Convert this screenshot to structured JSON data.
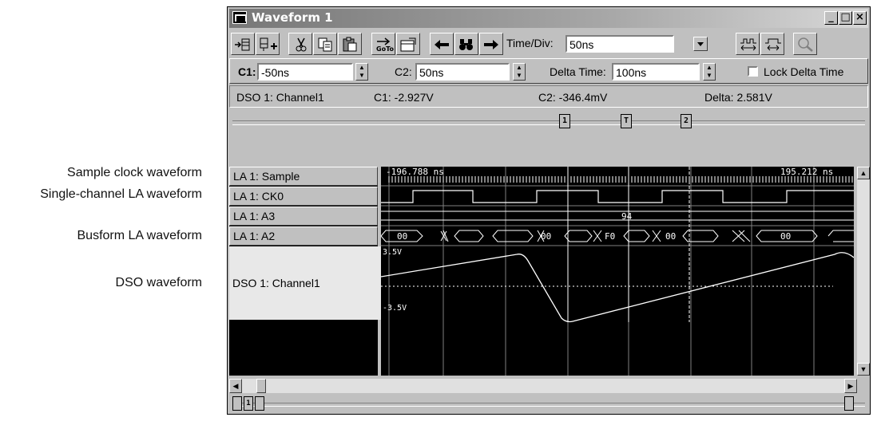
{
  "callouts": [
    "Sample clock waveform",
    "Single-channel LA waveform",
    "Busform LA waveform",
    "DSO waveform"
  ],
  "window": {
    "title": "Waveform 1",
    "controls": {
      "minimize": "_",
      "maximize": "□",
      "close": "×"
    }
  },
  "toolbar": {
    "timediv_label": "Time/Div:",
    "timediv_value": "50ns",
    "buttons": [
      "add-waveform",
      "add-group",
      "cut",
      "copy",
      "paste",
      "goto",
      "properties",
      "search-previous",
      "find",
      "search-next",
      "zoom-fit",
      "zoom-selection",
      "magnify"
    ]
  },
  "cursors": {
    "c1_label": "C1:",
    "c1_value": "-50ns",
    "c2_label": "C2:",
    "c2_value": "50ns",
    "delta_label": "Delta Time:",
    "delta_value": "100ns",
    "lock_label": "Lock Delta Time",
    "lock_checked": false
  },
  "readout": {
    "source": "DSO 1: Channel1",
    "c1": "C1: -2.927V",
    "c2": "C2: -346.4mV",
    "delta": "Delta: 2.581V"
  },
  "ruler_markers": [
    "1",
    "T",
    "2"
  ],
  "waveforms": [
    {
      "name": "LA 1: Sample"
    },
    {
      "name": "LA 1: CK0"
    },
    {
      "name": "LA 1: A3"
    },
    {
      "name": "LA 1: A2"
    },
    {
      "name": "DSO 1: Channel1"
    }
  ],
  "plot": {
    "time_left": "-196.788 ns",
    "time_right": "195.212 ns",
    "a3_value": "94",
    "a2_values": [
      "00",
      "00",
      "F0",
      "00",
      "00"
    ],
    "dso_top": "3.5V",
    "dso_bottom": "-3.5V"
  },
  "bottom_markers": [
    "1"
  ]
}
